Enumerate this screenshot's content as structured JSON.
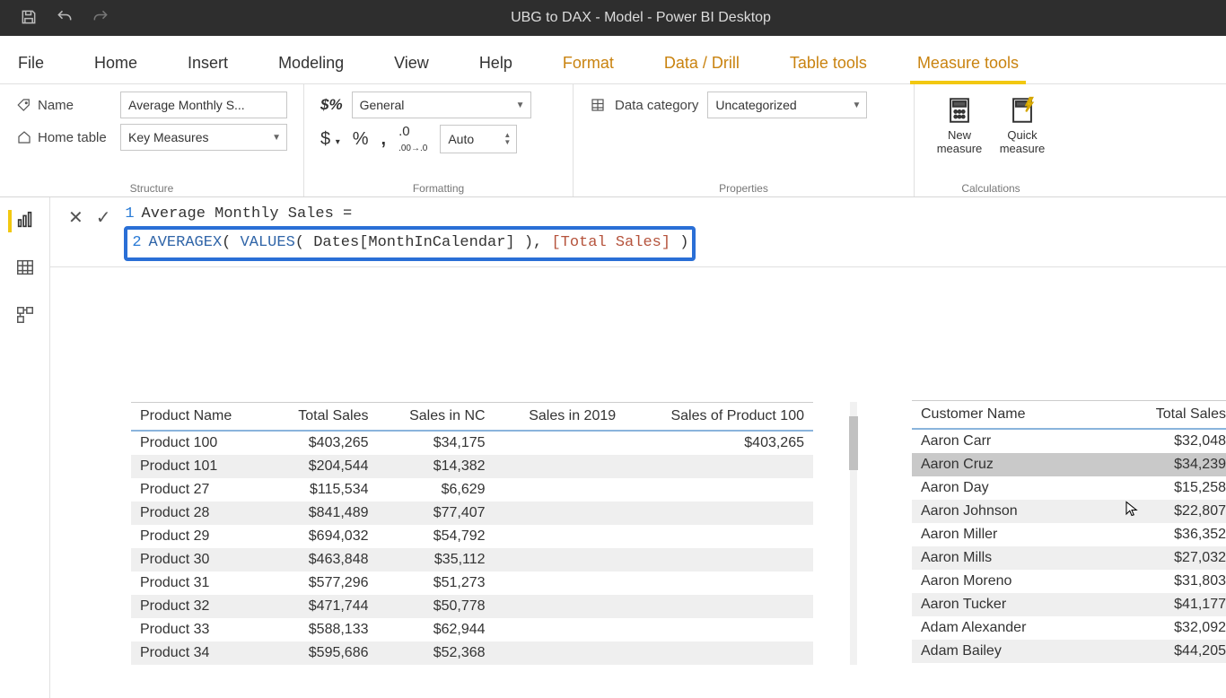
{
  "title": "UBG to DAX - Model - Power BI Desktop",
  "menu": {
    "file": "File",
    "tabs": [
      {
        "label": "Home",
        "context": false,
        "active": false
      },
      {
        "label": "Insert",
        "context": false,
        "active": false
      },
      {
        "label": "Modeling",
        "context": false,
        "active": false
      },
      {
        "label": "View",
        "context": false,
        "active": false
      },
      {
        "label": "Help",
        "context": false,
        "active": false
      },
      {
        "label": "Format",
        "context": true,
        "active": false
      },
      {
        "label": "Data / Drill",
        "context": true,
        "active": false
      },
      {
        "label": "Table tools",
        "context": true,
        "active": false
      },
      {
        "label": "Measure tools",
        "context": true,
        "active": true
      }
    ]
  },
  "ribbon": {
    "structure": {
      "name_label": "Name",
      "name_value": "Average Monthly S...",
      "home_table_label": "Home table",
      "home_table_value": "Key Measures",
      "group_label": "Structure"
    },
    "formatting": {
      "format_value": "General",
      "decimals_value": "Auto",
      "group_label": "Formatting"
    },
    "properties": {
      "data_cat_label": "Data category",
      "data_cat_value": "Uncategorized",
      "group_label": "Properties"
    },
    "calculations": {
      "new_measure": "New\nmeasure",
      "quick_measure": "Quick\nmeasure",
      "group_label": "Calculations"
    }
  },
  "formula": {
    "line1": "Average Monthly Sales =",
    "line2_parts": {
      "fn1": "AVERAGEX",
      "p1": "( ",
      "fn2": "VALUES",
      "p2": "( ",
      "col": "Dates[MonthInCalendar]",
      "p3": " ), ",
      "meas": "[Total Sales]",
      "p4": " )"
    }
  },
  "table_products": {
    "headers": [
      "Product Name",
      "Total Sales",
      "Sales in NC",
      "Sales in 2019",
      "Sales of Product 100"
    ],
    "rows": [
      [
        "Product 100",
        "$403,265",
        "$34,175",
        "",
        "$403,265"
      ],
      [
        "Product 101",
        "$204,544",
        "$14,382",
        "",
        ""
      ],
      [
        "Product 27",
        "$115,534",
        "$6,629",
        "",
        ""
      ],
      [
        "Product 28",
        "$841,489",
        "$77,407",
        "",
        ""
      ],
      [
        "Product 29",
        "$694,032",
        "$54,792",
        "",
        ""
      ],
      [
        "Product 30",
        "$463,848",
        "$35,112",
        "",
        ""
      ],
      [
        "Product 31",
        "$577,296",
        "$51,273",
        "",
        ""
      ],
      [
        "Product 32",
        "$471,744",
        "$50,778",
        "",
        ""
      ],
      [
        "Product 33",
        "$588,133",
        "$62,944",
        "",
        ""
      ],
      [
        "Product 34",
        "$595,686",
        "$52,368",
        "",
        ""
      ]
    ]
  },
  "table_customers": {
    "headers": [
      "Customer Name",
      "Total Sales"
    ],
    "rows": [
      [
        "Aaron Carr",
        "$32,048"
      ],
      [
        "Aaron Cruz",
        "$34,239"
      ],
      [
        "Aaron Day",
        "$15,258"
      ],
      [
        "Aaron Johnson",
        "$22,807"
      ],
      [
        "Aaron Miller",
        "$36,352"
      ],
      [
        "Aaron Mills",
        "$27,032"
      ],
      [
        "Aaron Moreno",
        "$31,803"
      ],
      [
        "Aaron Tucker",
        "$41,177"
      ],
      [
        "Adam Alexander",
        "$32,092"
      ],
      [
        "Adam Bailey",
        "$44,205"
      ]
    ],
    "selected_row": 1
  }
}
